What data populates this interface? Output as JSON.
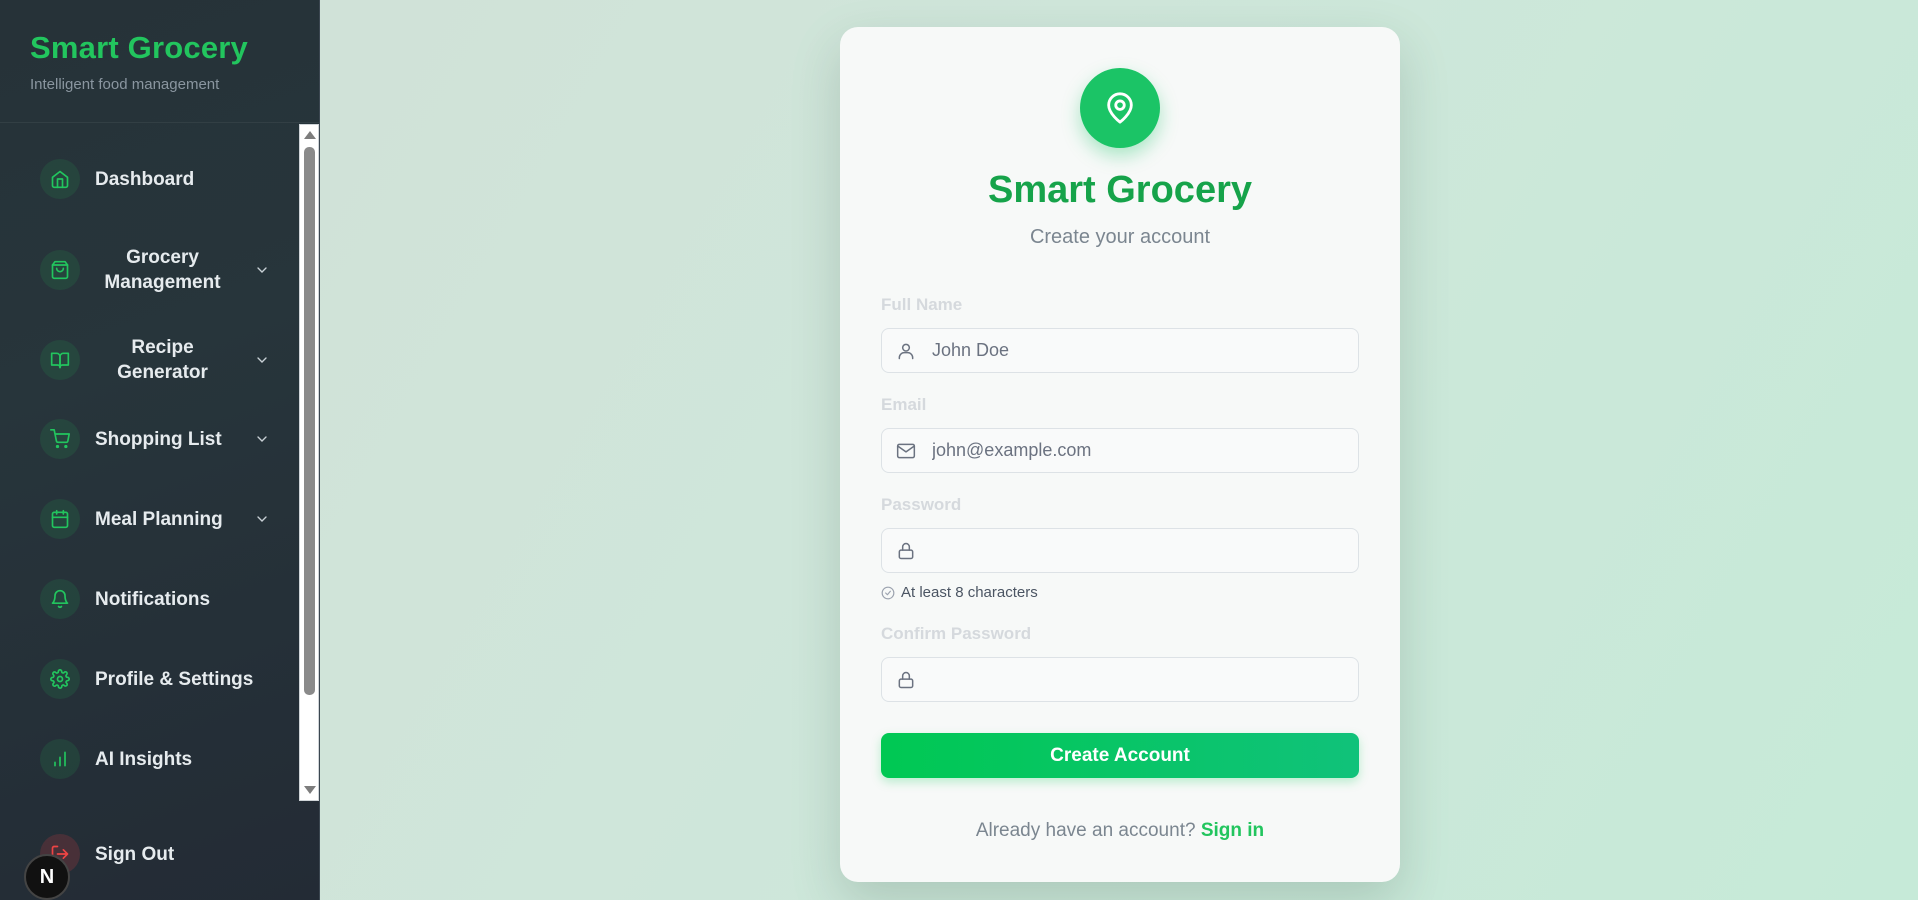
{
  "sidebar": {
    "brand_title": "Smart Grocery",
    "brand_subtitle": "Intelligent food management",
    "items": [
      {
        "label": "Dashboard",
        "icon": "home-icon",
        "expandable": false
      },
      {
        "label": "Grocery Management",
        "icon": "shopping-bag-icon",
        "expandable": true
      },
      {
        "label": "Recipe Generator",
        "icon": "book-open-icon",
        "expandable": true
      },
      {
        "label": "Shopping List",
        "icon": "cart-icon",
        "expandable": true
      },
      {
        "label": "Meal Planning",
        "icon": "calendar-icon",
        "expandable": true
      },
      {
        "label": "Notifications",
        "icon": "bell-icon",
        "expandable": false
      },
      {
        "label": "Profile & Settings",
        "icon": "gear-icon",
        "expandable": false
      },
      {
        "label": "AI Insights",
        "icon": "bar-chart-icon",
        "expandable": false
      }
    ],
    "sign_out": "Sign Out",
    "badge": "N"
  },
  "card": {
    "logo_icon": "map-pin-icon",
    "title": "Smart Grocery",
    "subtitle": "Create your account",
    "fields": {
      "full_name": {
        "label": "Full Name",
        "placeholder": "John Doe",
        "icon": "user-icon"
      },
      "email": {
        "label": "Email",
        "placeholder": "john@example.com",
        "icon": "mail-icon"
      },
      "password": {
        "label": "Password",
        "placeholder": "",
        "icon": "lock-icon"
      },
      "confirm_password": {
        "label": "Confirm Password",
        "placeholder": "",
        "icon": "lock-icon"
      }
    },
    "password_hint": "At least 8 characters",
    "submit_label": "Create Account",
    "signin_prompt": "Already have an account?",
    "signin_link": "Sign in"
  },
  "colors": {
    "brand_green": "#22c55e",
    "title_green": "#16a34a",
    "sidebar_bg": "#263238",
    "button_start": "#00c853",
    "button_end": "#10c27a"
  }
}
